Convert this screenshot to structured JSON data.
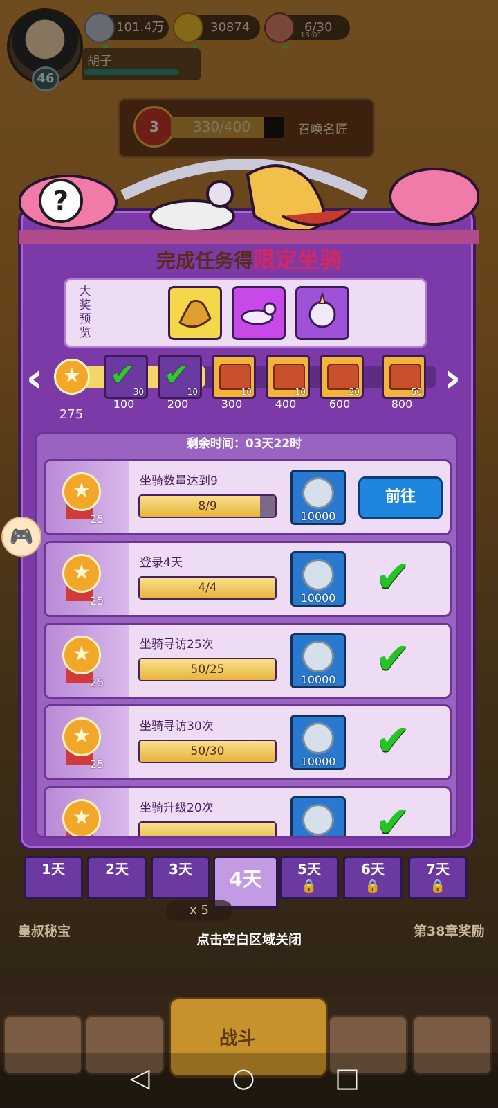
{
  "hud": {
    "silver": "101.4万",
    "gold": "30874",
    "stamina": "6/30",
    "stamina_timer": "13:01",
    "player_name": "胡子",
    "level": "46"
  },
  "summon": {
    "rank": "3",
    "progress_text": "330/400",
    "progress": 0.825,
    "label": "召唤名匠"
  },
  "panel": {
    "headline_a": "完成任务得",
    "headline_b": "限定坐骑",
    "preview_label": "大奖预览",
    "help": "?"
  },
  "track": {
    "current_points": "275",
    "milestones": [
      {
        "points": "100",
        "count": "30",
        "claimed": true
      },
      {
        "points": "200",
        "count": "10",
        "claimed": true
      },
      {
        "points": "300",
        "count": "10",
        "claimed": false
      },
      {
        "points": "400",
        "count": "10",
        "claimed": false
      },
      {
        "points": "600",
        "count": "20",
        "claimed": false
      },
      {
        "points": "800",
        "count": "50",
        "claimed": false
      }
    ]
  },
  "timer": "剩余时间：03天22时",
  "tasks": [
    {
      "title": "坐骑数量达到9",
      "progress": "8/9",
      "fraction": 0.889,
      "points": "25",
      "reward": "10000",
      "action": "前往",
      "done": false
    },
    {
      "title": "登录4天",
      "progress": "4/4",
      "fraction": 1.0,
      "points": "25",
      "reward": "10000",
      "done": true
    },
    {
      "title": "坐骑寻访25次",
      "progress": "50/25",
      "fraction": 1.0,
      "points": "25",
      "reward": "10000",
      "done": true
    },
    {
      "title": "坐骑寻访30次",
      "progress": "50/30",
      "fraction": 1.0,
      "points": "25",
      "reward": "10000",
      "done": true
    },
    {
      "title": "坐骑升级20次",
      "progress": "",
      "fraction": 1.0,
      "points": "25",
      "reward": "10000",
      "done": true
    }
  ],
  "days": [
    {
      "label": "1天",
      "locked": false
    },
    {
      "label": "2天",
      "locked": false
    },
    {
      "label": "3天",
      "locked": false
    },
    {
      "label": "4天",
      "locked": false,
      "selected": true
    },
    {
      "label": "5天",
      "locked": true
    },
    {
      "label": "6天",
      "locked": true
    },
    {
      "label": "7天",
      "locked": true
    }
  ],
  "close_hint": "点击空白区域关闭",
  "side": {
    "left_label": "皇叔秘宝",
    "right_label": "第38章奖励",
    "stamina_cost": "x 5",
    "battle": "战斗"
  },
  "colors": {
    "panel": "#7b3aa8",
    "accent_pink": "#d8265e",
    "check_green": "#25c425",
    "go_blue": "#1f86e0"
  }
}
